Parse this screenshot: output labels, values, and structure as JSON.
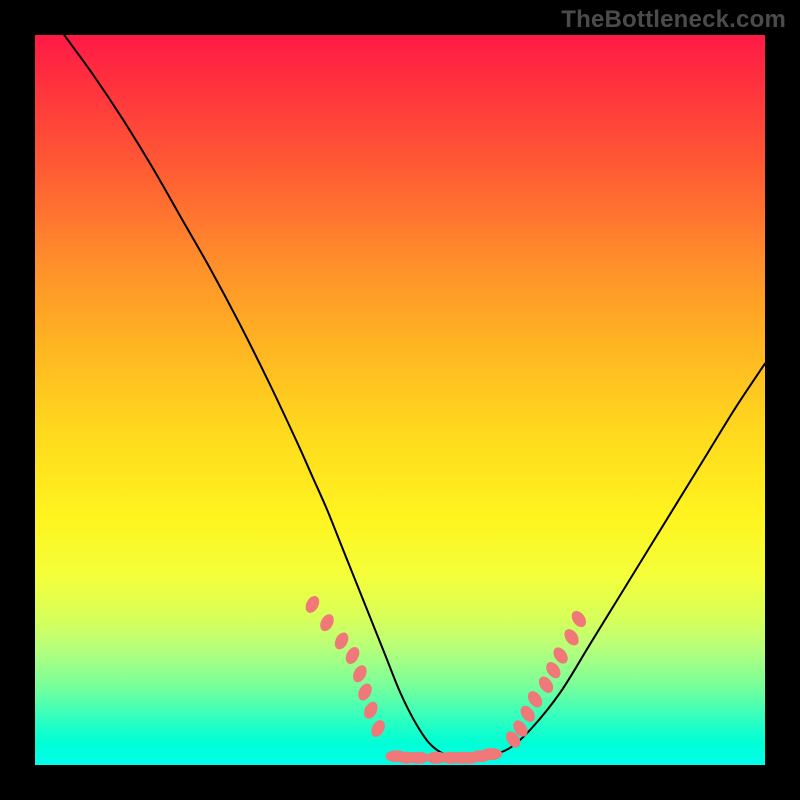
{
  "watermark": "TheBottleneck.com",
  "colors": {
    "background": "#000000",
    "curve": "#000000",
    "marker": "#f07878",
    "watermark": "#4b4b4b",
    "gradient_top": "#ff1a46",
    "gradient_bottom": "#00ffea"
  },
  "chart_data": {
    "type": "line",
    "title": "",
    "xlabel": "",
    "ylabel": "",
    "xlim": [
      0,
      100
    ],
    "ylim": [
      0,
      100
    ],
    "grid": false,
    "legend": false,
    "x": [
      4,
      8,
      12,
      16,
      20,
      24,
      28,
      32,
      36,
      38,
      40,
      42,
      44,
      46,
      48,
      50,
      52,
      54,
      56,
      58,
      60,
      62,
      65,
      68,
      72,
      76,
      80,
      84,
      88,
      92,
      96,
      100
    ],
    "values": [
      100,
      94.5,
      88.5,
      82,
      75,
      68,
      60.5,
      52.5,
      44,
      39.5,
      35,
      30,
      25,
      20,
      15,
      10,
      6,
      3,
      1.5,
      1,
      1,
      1.2,
      2.3,
      5,
      10,
      16.5,
      23,
      29.5,
      36,
      42.5,
      49,
      55
    ],
    "series": [
      {
        "name": "markers-left",
        "x": [
          38,
          40,
          42,
          43.5,
          44.5,
          45.2,
          46,
          47
        ],
        "values": [
          22,
          19.5,
          17,
          15,
          12.5,
          10,
          7.5,
          5
        ]
      },
      {
        "name": "markers-bottom",
        "x": [
          49.5,
          51,
          52.5,
          55,
          57,
          58.5,
          59.5,
          61,
          62.5
        ],
        "values": [
          1.2,
          1.0,
          1.0,
          1.0,
          1.0,
          1.0,
          1.0,
          1.2,
          1.5
        ]
      },
      {
        "name": "markers-right",
        "x": [
          65.5,
          66.5,
          67.5,
          68.5,
          70,
          71,
          72,
          73.5,
          74.5
        ],
        "values": [
          3.5,
          5,
          7,
          9,
          11,
          13,
          15,
          17.5,
          20
        ]
      }
    ]
  }
}
